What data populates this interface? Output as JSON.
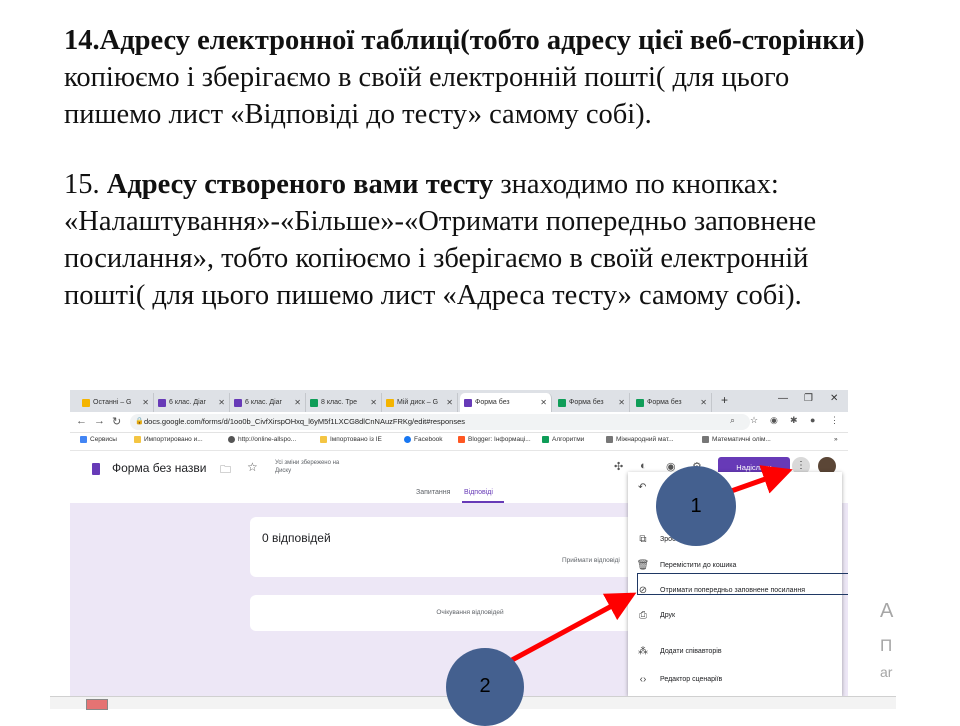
{
  "slide": {
    "p14_bold": "14.Адресу електронної таблиці(тобто адресу цієї  веб-сторінки)",
    "p14_rest": " копіюємо і зберігаємо в своїй електронній пошті( для цього пишемо лист «Відповіді до тесту» самому собі).",
    "p15_num": "15. ",
    "p15_bold": "Адресу створеного вами тесту",
    "p15_rest": " знаходимо по кнопках: «Налаштування»-«Більше»-«Отримати попередньо заповнене посилання», тобто копіюємо і зберігаємо в своїй електронній пошті( для цього пишемо лист «Адреса   тесту» самому собі)."
  },
  "browser": {
    "tabs": [
      {
        "label": "Останні – G",
        "color": "#f4b400"
      },
      {
        "label": "6 клас. Діаг",
        "color": "#673ab7"
      },
      {
        "label": "6 клас. Діаг",
        "color": "#673ab7"
      },
      {
        "label": "8 клас. Тре",
        "color": "#0f9d58"
      },
      {
        "label": "Мій диск – G",
        "color": "#f4b400"
      },
      {
        "label": "Форма без",
        "color": "#673ab7"
      },
      {
        "label": "Форма без",
        "color": "#0f9d58"
      },
      {
        "label": "Форма без",
        "color": "#0f9d58"
      }
    ],
    "url": "docs.google.com/forms/d/1oo0b_CivfXirspOHxq_l6yM5f1LXCG8dlCnNAuzFRKg/edit#responses",
    "bookmarks": [
      "Сервисы",
      "Импортировано и...",
      "http://online-allspo...",
      "Імпортовано із IE",
      "Facebook",
      "Blogger: Інформаці...",
      "Алгоритми",
      "Міжнародний мат...",
      "Математичні олім..."
    ],
    "bookmarks_more": "»"
  },
  "form": {
    "title": "Форма без назви",
    "saved_note": "Усі зміни збережено на Диску",
    "send_button": "Надіслати",
    "tab_questions": "Запитання",
    "tab_responses": "Відповіді",
    "zero_responses": "0 відповідей",
    "accepting": "Приймати відповіді",
    "waiting": "Очікування відповідей"
  },
  "menu": {
    "items": [
      {
        "icon": "⧉",
        "label": "Зробити копію"
      },
      {
        "icon": "🗑",
        "label": "Перемістити до кошика"
      },
      {
        "icon": "⊘",
        "label": "Отримати попередньо заповнене посилання"
      },
      {
        "icon": "⎙",
        "label": "Друк"
      },
      {
        "icon": "⁂",
        "label": "Додати співавторів"
      },
      {
        "icon": "‹›",
        "label": "Редактор сценаріїв"
      }
    ]
  },
  "ghost_text": {
    "line1": "А",
    "line2": "П",
    "line3": "ar"
  },
  "callouts": {
    "one": "1",
    "two": "2"
  },
  "colors": {
    "form_purple": "#673ab7",
    "callout_fill": "#44608f",
    "arrow_red": "#ff0000"
  }
}
